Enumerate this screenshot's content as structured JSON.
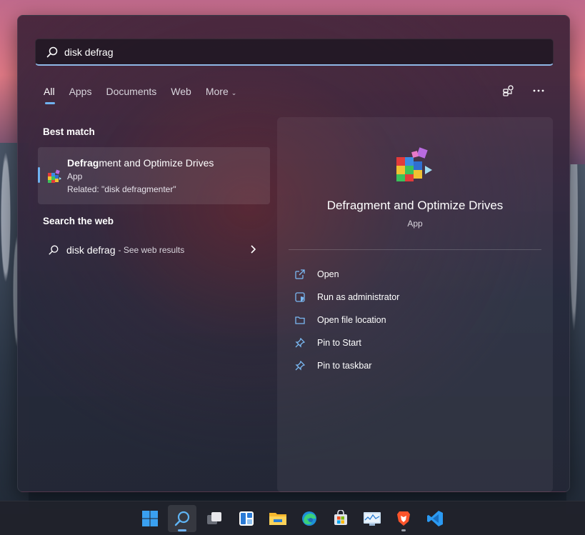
{
  "search": {
    "query": "disk defrag"
  },
  "tabs": [
    {
      "label": "All"
    },
    {
      "label": "Apps"
    },
    {
      "label": "Documents"
    },
    {
      "label": "Web"
    },
    {
      "label": "More"
    }
  ],
  "best_match": {
    "section_label": "Best match",
    "name_bold": "Defrag",
    "name_rest": "ment and Optimize Drives",
    "type": "App",
    "related": "Related: \"disk defragmenter\""
  },
  "web": {
    "section_label": "Search the web",
    "query": "disk defrag",
    "hint": "- See web results"
  },
  "preview": {
    "title": "Defragment and Optimize Drives",
    "type": "App",
    "actions": [
      {
        "label": "Open",
        "icon": "open-external-icon"
      },
      {
        "label": "Run as administrator",
        "icon": "shield-icon"
      },
      {
        "label": "Open file location",
        "icon": "folder-icon"
      },
      {
        "label": "Pin to Start",
        "icon": "pin-icon"
      },
      {
        "label": "Pin to taskbar",
        "icon": "pin-icon"
      }
    ]
  },
  "taskbar": {
    "items": [
      {
        "name": "start",
        "icon": "windows-logo-icon"
      },
      {
        "name": "search",
        "icon": "search-icon",
        "active": true
      },
      {
        "name": "task-view",
        "icon": "task-view-icon"
      },
      {
        "name": "widgets",
        "icon": "widgets-icon"
      },
      {
        "name": "file-explorer",
        "icon": "folder-icon"
      },
      {
        "name": "edge",
        "icon": "edge-icon"
      },
      {
        "name": "microsoft-store",
        "icon": "store-icon"
      },
      {
        "name": "resource-monitor",
        "icon": "monitor-chart-icon"
      },
      {
        "name": "brave",
        "icon": "brave-icon",
        "running": true
      },
      {
        "name": "vscode",
        "icon": "vscode-icon"
      }
    ]
  },
  "colors": {
    "accent": "#6fb2f0"
  }
}
